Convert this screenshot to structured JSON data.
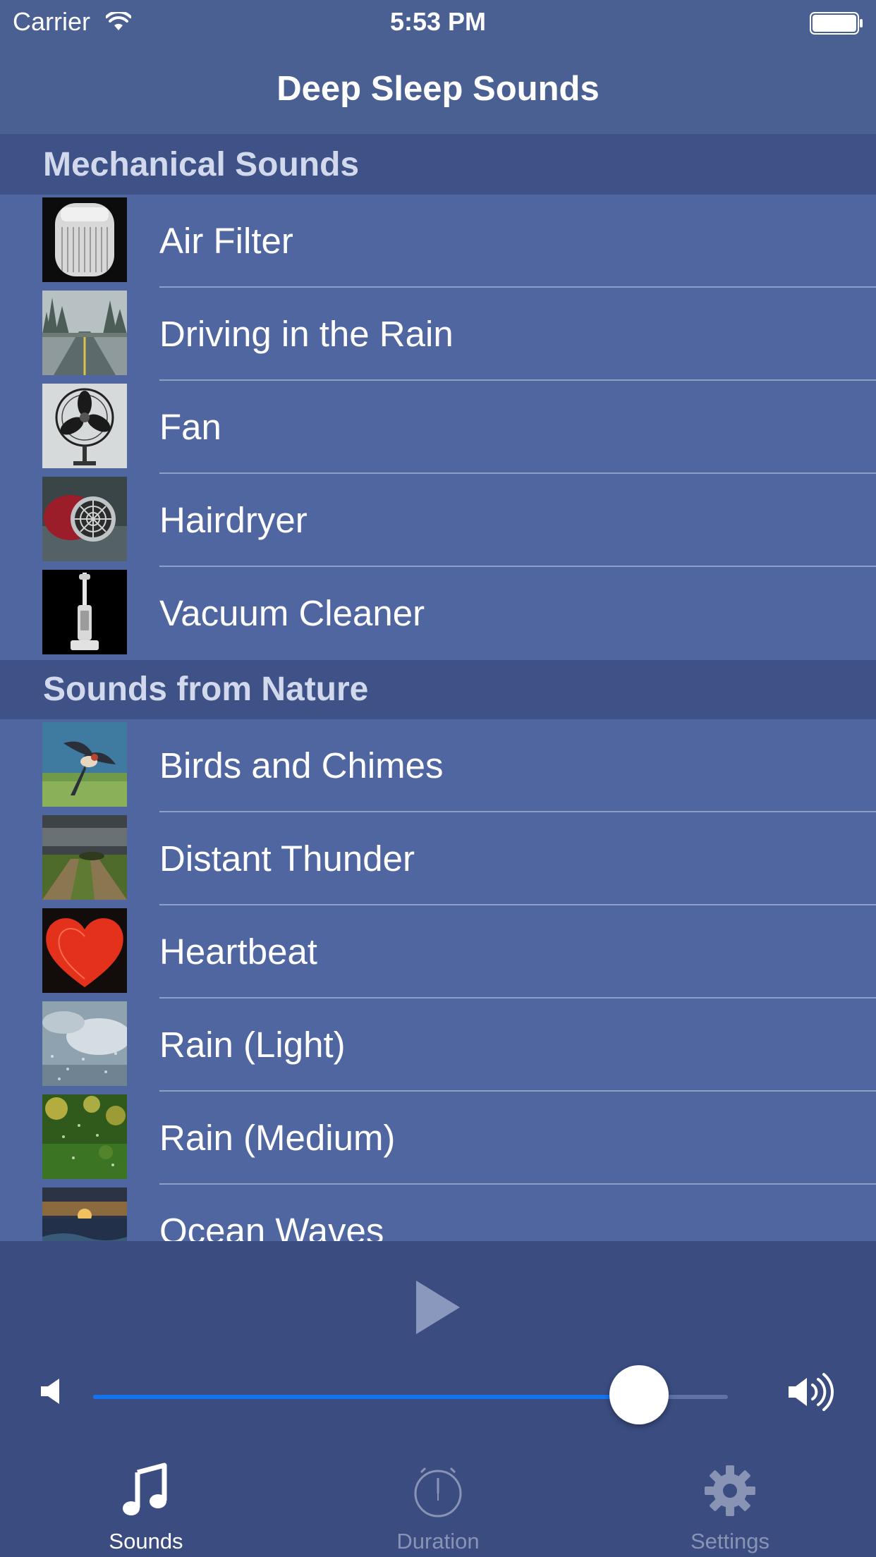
{
  "status": {
    "carrier": "Carrier",
    "time": "5:53 PM"
  },
  "nav": {
    "title": "Deep Sleep Sounds"
  },
  "sections": [
    {
      "title": "Mechanical Sounds",
      "items": [
        {
          "label": "Air Filter",
          "thumb": "air-filter"
        },
        {
          "label": "Driving in the Rain",
          "thumb": "road-rain"
        },
        {
          "label": "Fan",
          "thumb": "fan"
        },
        {
          "label": "Hairdryer",
          "thumb": "hairdryer"
        },
        {
          "label": "Vacuum Cleaner",
          "thumb": "vacuum"
        }
      ]
    },
    {
      "title": "Sounds from Nature",
      "items": [
        {
          "label": "Birds and Chimes",
          "thumb": "bird"
        },
        {
          "label": "Distant Thunder",
          "thumb": "thunder"
        },
        {
          "label": "Heartbeat",
          "thumb": "heart"
        },
        {
          "label": "Rain (Light)",
          "thumb": "rain-light"
        },
        {
          "label": "Rain (Medium)",
          "thumb": "rain-medium"
        },
        {
          "label": "Ocean Waves",
          "thumb": "ocean"
        }
      ]
    }
  ],
  "player": {
    "play_icon": "play-icon",
    "volume": 0.86,
    "accent": "#1473ee"
  },
  "tabs": [
    {
      "label": "Sounds",
      "icon": "music-note-icon",
      "active": true
    },
    {
      "label": "Duration",
      "icon": "stopwatch-icon",
      "active": false
    },
    {
      "label": "Settings",
      "icon": "gear-icon",
      "active": false
    }
  ]
}
